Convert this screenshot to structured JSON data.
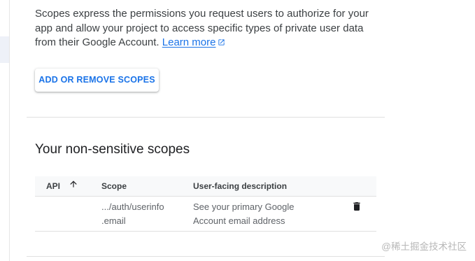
{
  "intro": {
    "text": "Scopes express the permissions you request users to authorize for your app and allow your project to access specific types of private user data from their Google Account.",
    "link_label": "Learn more",
    "link_icon": "external-link-icon"
  },
  "actions": {
    "add_remove_label": "ADD OR REMOVE SCOPES"
  },
  "section": {
    "title": "Your non-sensitive scopes"
  },
  "table": {
    "headers": {
      "api": "API",
      "scope": "Scope",
      "description": "User-facing description"
    },
    "sort_icon": "arrow-up-icon",
    "rows": [
      {
        "api": "",
        "scope_line1": ".../auth/userinfo",
        "scope_line2": ".email",
        "description_line1": "See your primary Google",
        "description_line2": "Account email address",
        "action_icon": "trash-icon"
      }
    ]
  },
  "watermark": "@稀土掘金技术社区",
  "colors": {
    "accent": "#1a73e8",
    "text_primary": "#202124",
    "text_secondary": "#5f6368",
    "divider": "#e0e0e0",
    "header_bg": "#f8f9fa"
  }
}
